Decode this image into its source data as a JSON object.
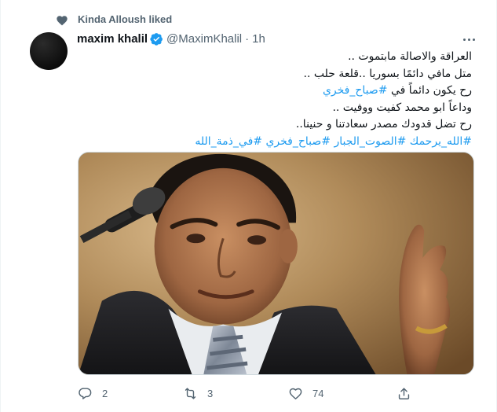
{
  "social_context": {
    "text": "Kinda Alloush liked"
  },
  "author": {
    "display_name": "maxim khalil",
    "handle": "@MaximKhalil",
    "separator": "·",
    "time": "1h",
    "verified": true
  },
  "tweet": {
    "lines": [
      {
        "text": "العراقة والاصالة مابتموت .."
      },
      {
        "text": "متل مافي دائمًا بسوريا ..قلعة حلب .."
      },
      {
        "prefix": "رح يكون دائماً في ",
        "tag": "#صباح_فخري"
      },
      {
        "text": "وداعاً ابو محمد كفيت ووفيت .."
      },
      {
        "text": "رح تضل قدودك  مصدر سعادتنا و حنينا.."
      },
      {
        "tags": "#الله_يرحمك #الصوت_الجبار #صباح_فخري #في_ذمة_الله"
      }
    ]
  },
  "actions": {
    "reply_count": "2",
    "retweet_count": "3",
    "like_count": "74"
  },
  "icons": {
    "social": "heart-icon",
    "verified": "verified-badge-icon",
    "more": "more-icon",
    "reply": "reply-icon",
    "retweet": "retweet-icon",
    "like": "like-icon",
    "share": "share-icon"
  },
  "colors": {
    "link": "#1d9bf0",
    "secondary_text": "#536471",
    "primary_text": "#0f1419",
    "verified": "#1d9bf0"
  }
}
